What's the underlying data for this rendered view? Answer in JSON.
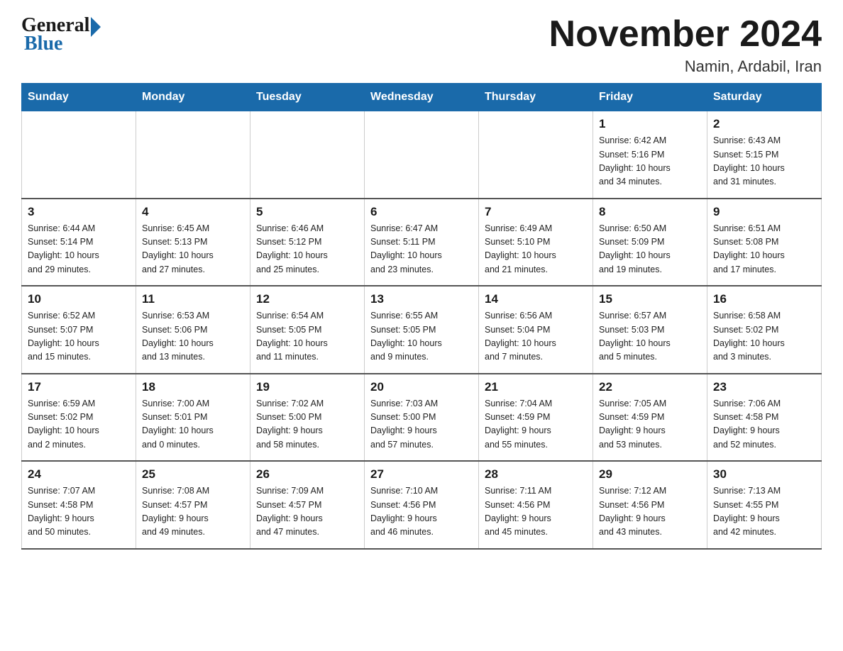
{
  "header": {
    "logo_general": "General",
    "logo_blue": "Blue",
    "month_title": "November 2024",
    "subtitle": "Namin, Ardabil, Iran"
  },
  "days_of_week": [
    "Sunday",
    "Monday",
    "Tuesday",
    "Wednesday",
    "Thursday",
    "Friday",
    "Saturday"
  ],
  "weeks": [
    [
      {
        "day": "",
        "info": ""
      },
      {
        "day": "",
        "info": ""
      },
      {
        "day": "",
        "info": ""
      },
      {
        "day": "",
        "info": ""
      },
      {
        "day": "",
        "info": ""
      },
      {
        "day": "1",
        "info": "Sunrise: 6:42 AM\nSunset: 5:16 PM\nDaylight: 10 hours\nand 34 minutes."
      },
      {
        "day": "2",
        "info": "Sunrise: 6:43 AM\nSunset: 5:15 PM\nDaylight: 10 hours\nand 31 minutes."
      }
    ],
    [
      {
        "day": "3",
        "info": "Sunrise: 6:44 AM\nSunset: 5:14 PM\nDaylight: 10 hours\nand 29 minutes."
      },
      {
        "day": "4",
        "info": "Sunrise: 6:45 AM\nSunset: 5:13 PM\nDaylight: 10 hours\nand 27 minutes."
      },
      {
        "day": "5",
        "info": "Sunrise: 6:46 AM\nSunset: 5:12 PM\nDaylight: 10 hours\nand 25 minutes."
      },
      {
        "day": "6",
        "info": "Sunrise: 6:47 AM\nSunset: 5:11 PM\nDaylight: 10 hours\nand 23 minutes."
      },
      {
        "day": "7",
        "info": "Sunrise: 6:49 AM\nSunset: 5:10 PM\nDaylight: 10 hours\nand 21 minutes."
      },
      {
        "day": "8",
        "info": "Sunrise: 6:50 AM\nSunset: 5:09 PM\nDaylight: 10 hours\nand 19 minutes."
      },
      {
        "day": "9",
        "info": "Sunrise: 6:51 AM\nSunset: 5:08 PM\nDaylight: 10 hours\nand 17 minutes."
      }
    ],
    [
      {
        "day": "10",
        "info": "Sunrise: 6:52 AM\nSunset: 5:07 PM\nDaylight: 10 hours\nand 15 minutes."
      },
      {
        "day": "11",
        "info": "Sunrise: 6:53 AM\nSunset: 5:06 PM\nDaylight: 10 hours\nand 13 minutes."
      },
      {
        "day": "12",
        "info": "Sunrise: 6:54 AM\nSunset: 5:05 PM\nDaylight: 10 hours\nand 11 minutes."
      },
      {
        "day": "13",
        "info": "Sunrise: 6:55 AM\nSunset: 5:05 PM\nDaylight: 10 hours\nand 9 minutes."
      },
      {
        "day": "14",
        "info": "Sunrise: 6:56 AM\nSunset: 5:04 PM\nDaylight: 10 hours\nand 7 minutes."
      },
      {
        "day": "15",
        "info": "Sunrise: 6:57 AM\nSunset: 5:03 PM\nDaylight: 10 hours\nand 5 minutes."
      },
      {
        "day": "16",
        "info": "Sunrise: 6:58 AM\nSunset: 5:02 PM\nDaylight: 10 hours\nand 3 minutes."
      }
    ],
    [
      {
        "day": "17",
        "info": "Sunrise: 6:59 AM\nSunset: 5:02 PM\nDaylight: 10 hours\nand 2 minutes."
      },
      {
        "day": "18",
        "info": "Sunrise: 7:00 AM\nSunset: 5:01 PM\nDaylight: 10 hours\nand 0 minutes."
      },
      {
        "day": "19",
        "info": "Sunrise: 7:02 AM\nSunset: 5:00 PM\nDaylight: 9 hours\nand 58 minutes."
      },
      {
        "day": "20",
        "info": "Sunrise: 7:03 AM\nSunset: 5:00 PM\nDaylight: 9 hours\nand 57 minutes."
      },
      {
        "day": "21",
        "info": "Sunrise: 7:04 AM\nSunset: 4:59 PM\nDaylight: 9 hours\nand 55 minutes."
      },
      {
        "day": "22",
        "info": "Sunrise: 7:05 AM\nSunset: 4:59 PM\nDaylight: 9 hours\nand 53 minutes."
      },
      {
        "day": "23",
        "info": "Sunrise: 7:06 AM\nSunset: 4:58 PM\nDaylight: 9 hours\nand 52 minutes."
      }
    ],
    [
      {
        "day": "24",
        "info": "Sunrise: 7:07 AM\nSunset: 4:58 PM\nDaylight: 9 hours\nand 50 minutes."
      },
      {
        "day": "25",
        "info": "Sunrise: 7:08 AM\nSunset: 4:57 PM\nDaylight: 9 hours\nand 49 minutes."
      },
      {
        "day": "26",
        "info": "Sunrise: 7:09 AM\nSunset: 4:57 PM\nDaylight: 9 hours\nand 47 minutes."
      },
      {
        "day": "27",
        "info": "Sunrise: 7:10 AM\nSunset: 4:56 PM\nDaylight: 9 hours\nand 46 minutes."
      },
      {
        "day": "28",
        "info": "Sunrise: 7:11 AM\nSunset: 4:56 PM\nDaylight: 9 hours\nand 45 minutes."
      },
      {
        "day": "29",
        "info": "Sunrise: 7:12 AM\nSunset: 4:56 PM\nDaylight: 9 hours\nand 43 minutes."
      },
      {
        "day": "30",
        "info": "Sunrise: 7:13 AM\nSunset: 4:55 PM\nDaylight: 9 hours\nand 42 minutes."
      }
    ]
  ]
}
